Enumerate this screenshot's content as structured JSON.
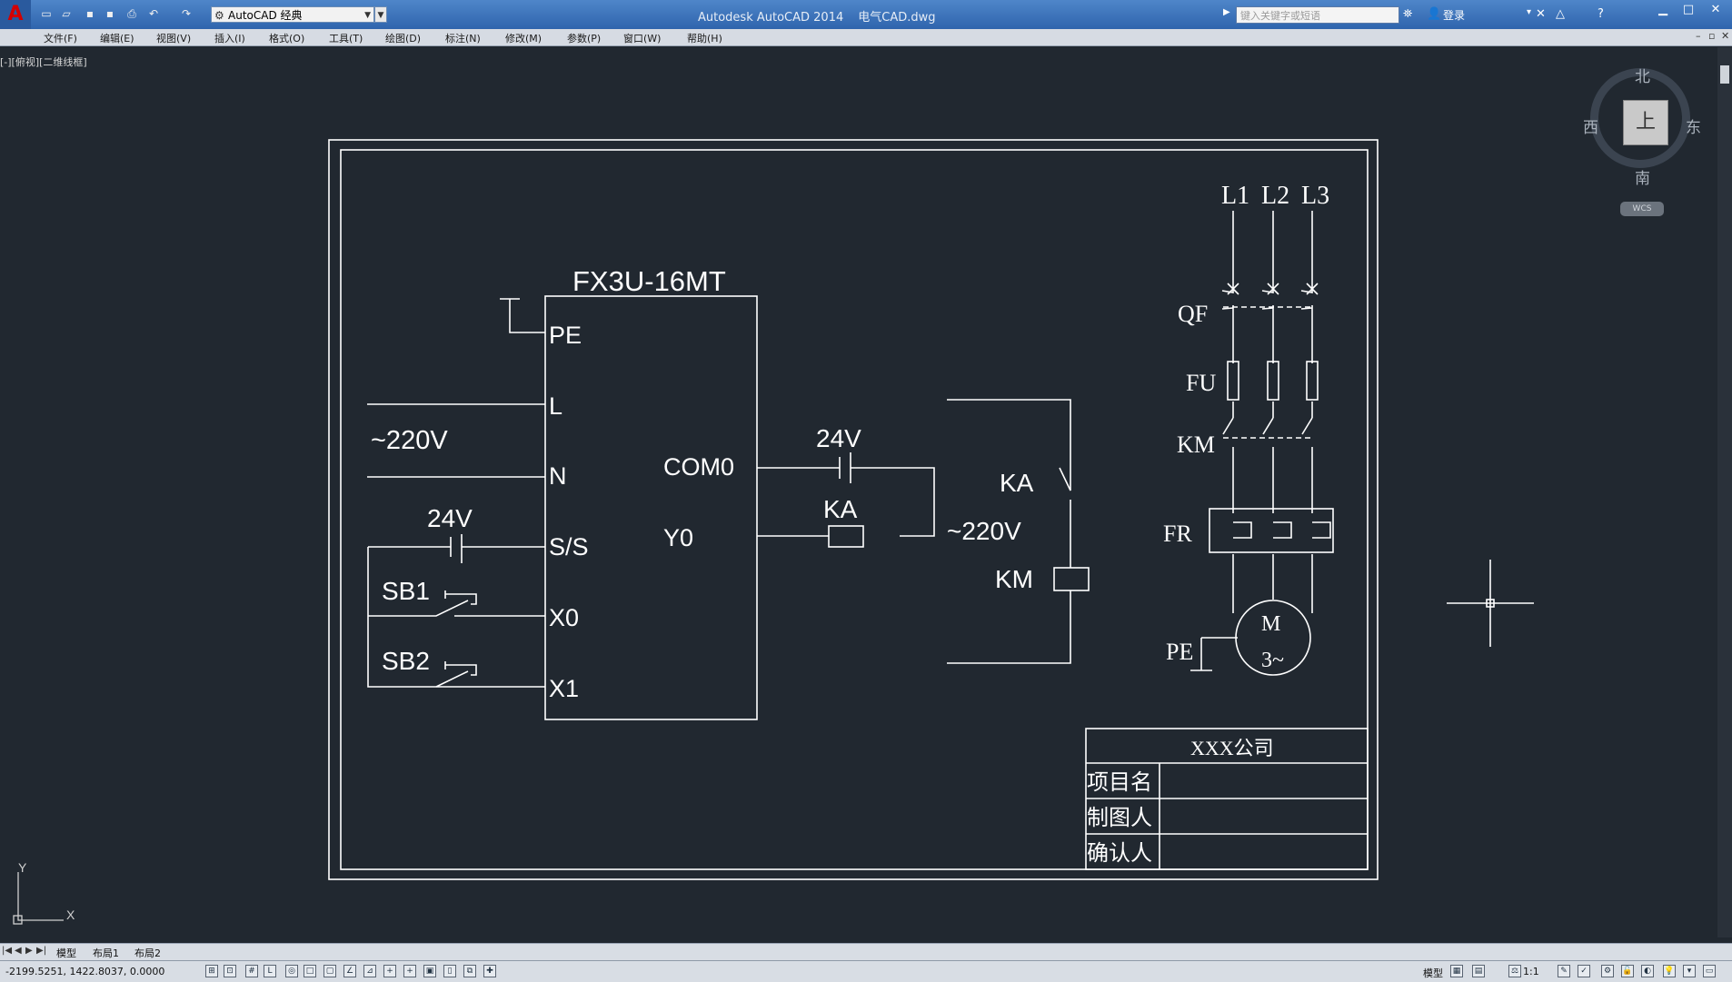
{
  "title_bar": {
    "app_title": "Autodesk AutoCAD 2014",
    "file_name": "电气CAD.dwg",
    "workspace": "AutoCAD 经典",
    "search_placeholder": "键入关键字或短语",
    "login_label": "登录"
  },
  "menu": [
    "文件(F)",
    "编辑(E)",
    "视图(V)",
    "插入(I)",
    "格式(O)",
    "工具(T)",
    "绘图(D)",
    "标注(N)",
    "修改(M)",
    "参数(P)",
    "窗口(W)",
    "帮助(H)"
  ],
  "viewport_label": "[-][俯视][二维线框]",
  "viewcube": {
    "north": "北",
    "south": "南",
    "east": "东",
    "west": "西",
    "face": "上",
    "wcs": "WCS"
  },
  "drawing": {
    "plc": {
      "model": "FX3U-16MT",
      "left_terminals": [
        "PE",
        "L",
        "N",
        "S/S",
        "X0",
        "X1"
      ],
      "right_terminals": [
        "COM0",
        "Y0"
      ]
    },
    "power_label": "~220V",
    "dc_label_input": "24V",
    "dc_label_output": "24V",
    "buttons": [
      "SB1",
      "SB2"
    ],
    "relay_coil": "KA",
    "control_circuit": {
      "contact": "KA",
      "supply": "~220V",
      "coil": "KM"
    },
    "main_circuit": {
      "phases": [
        "L1",
        "L2",
        "L3"
      ],
      "breaker": "QF",
      "fuse": "FU",
      "contactor": "KM",
      "overload": "FR",
      "ground": "PE",
      "motor_top": "M",
      "motor_bottom": "3~"
    },
    "title_block": {
      "company": "XXX公司",
      "rows": [
        "项目名",
        "制图人",
        "确认人"
      ]
    }
  },
  "ucs": {
    "x": "X",
    "y": "Y"
  },
  "layout_tabs": [
    "模型",
    "布局1",
    "布局2"
  ],
  "status": {
    "coordinates": "-2199.5251, 1422.8037, 0.0000",
    "model_label": "模型",
    "scale": "1:1"
  }
}
